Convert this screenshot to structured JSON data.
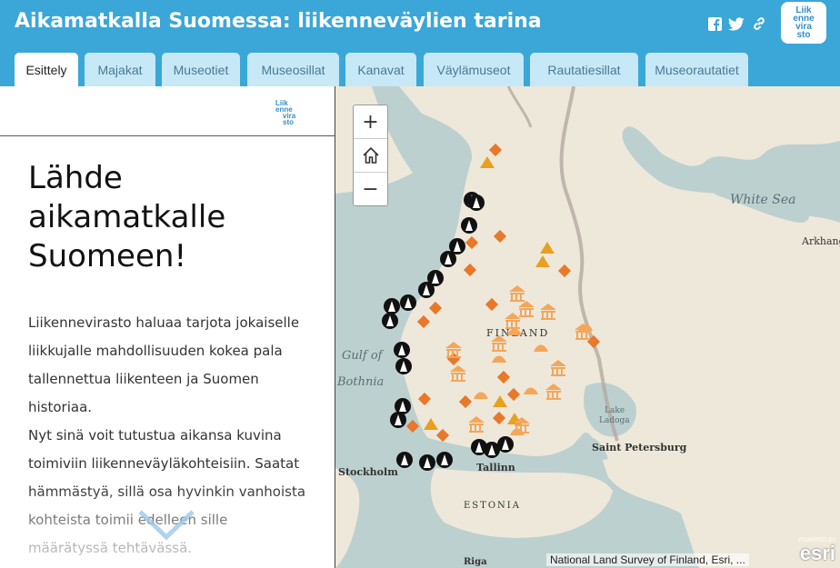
{
  "header": {
    "title": "Aikamatkalla Suomessa: liikenneväylien tarina",
    "social_icons": [
      "facebook-icon",
      "twitter-icon",
      "link-icon"
    ],
    "logo_lines": [
      "Liik",
      "enne",
      "vira",
      "sto"
    ],
    "colors": {
      "bar": "#3aa7d8",
      "tab": "#c7e8f7"
    }
  },
  "tabs": [
    {
      "label": "Esittely",
      "active": true
    },
    {
      "label": "Majakat",
      "active": false
    },
    {
      "label": "Museotiet",
      "active": false
    },
    {
      "label": "Museosillat",
      "active": false
    },
    {
      "label": "Kanavat",
      "active": false
    },
    {
      "label": "Väylämuseot",
      "active": false
    },
    {
      "label": "Rautatiesillat",
      "active": false
    },
    {
      "label": "Museorautatiet",
      "active": false
    }
  ],
  "panel": {
    "logo_lines": [
      "Liik",
      "enne",
      "vira",
      "sto"
    ],
    "heading_lines": [
      "Lähde",
      "aikamatkalle",
      "Suomeen!"
    ],
    "paragraph_lines": [
      "Liikennevirasto haluaa tarjota jokaiselle",
      "liikkujalle mahdollisuuden kokea pala",
      "tallennettua liikenteen ja Suomen",
      "historiaa.",
      "Nyt sinä voit tutustua aikansa kuvina",
      "toimiviin liikenneväyläkohteisiin. Saatat",
      "hämmästyä, sillä osa hyvinkin vanhoista",
      "kohteista toimii edelleen sille",
      "määrätyssä tehtävässä."
    ]
  },
  "map": {
    "zoom_in": "+",
    "zoom_out": "−",
    "home_icon": "home-icon",
    "labels": {
      "white_sea": "White Sea",
      "arkhangelsk": "Arkhang",
      "finland": "FINLAND",
      "gulf_1": "Gulf of",
      "gulf_2": "Bothnia",
      "lake_1": "Lake",
      "lake_2": "Ladoga",
      "st_petersburg": "Saint Petersburg",
      "stockholm": "Stockholm",
      "tallinn": "Tallinn",
      "estonia": "ESTONIA",
      "riga": "Riga"
    },
    "attribution": "National Land Survey of Finland, Esri, ...",
    "powered_by": "POWERED BY",
    "esri": "esri",
    "colors": {
      "marker_orange": "#e8782a",
      "marker_light": "#f4a65a",
      "lighthouse": "#111111",
      "sea": "#b9cfcf",
      "land": "#efe9dc"
    }
  }
}
